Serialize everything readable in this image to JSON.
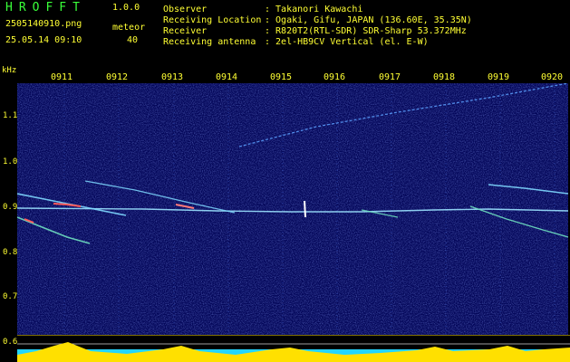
{
  "header": {
    "logo": "HROFFT",
    "version": "1.0.0",
    "filename": "2505140910.png",
    "meteor_label": "meteor",
    "datetime": "25.05.14 09:10",
    "meteor_count": "40"
  },
  "info": [
    {
      "label": "Observer",
      "value": ": Takanori Kawachi"
    },
    {
      "label": "Receiving Location",
      "value": ": Ogaki, Gifu, JAPAN (136.60E, 35.35N)"
    },
    {
      "label": "Receiver",
      "value": ": R820T2(RTL-SDR) SDR-Sharp 53.372MHz"
    },
    {
      "label": "Receiving antenna",
      "value": ": 2el-HB9CV Vertical (el. E-W)"
    }
  ],
  "axis": {
    "unit": "kHz",
    "time_ticks": [
      "0911",
      "0912",
      "0913",
      "0914",
      "0915",
      "0916",
      "0917",
      "0918",
      "0919",
      "0920"
    ],
    "freq_ticks": [
      "1.1",
      "1.0",
      "0.9",
      "0.8",
      "0.7",
      "0.6"
    ]
  },
  "colors": {
    "label": "#ffff33",
    "logo": "#39ff39",
    "background": "#04075a",
    "signal": "#7fd9ff",
    "echo": "#ff5a5a",
    "level": "#ffe000",
    "baseline": "#22d5ff"
  }
}
